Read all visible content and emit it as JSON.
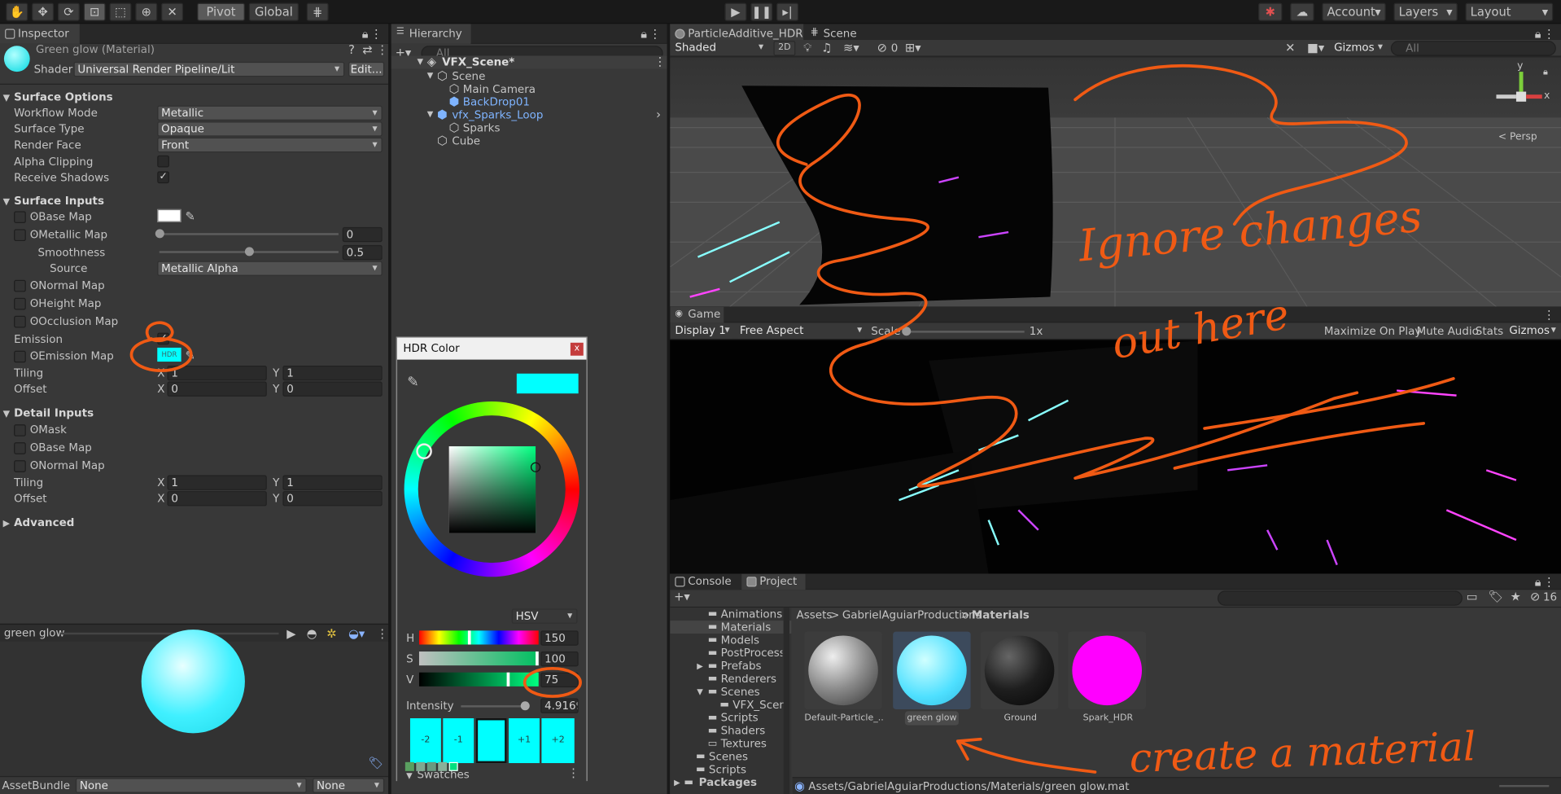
{
  "toolbar": {
    "pivot_label": "Pivot",
    "global_label": "Global",
    "account_label": "Account",
    "layers_label": "Layers",
    "layout_label": "Layout"
  },
  "inspector": {
    "tab_label": "Inspector",
    "material_name": "Green glow (Material)",
    "shader_label": "Shader",
    "shader_value": "Universal Render Pipeline/Lit",
    "edit_label": "Edit...",
    "surface_options": {
      "title": "Surface Options",
      "workflow_mode_label": "Workflow Mode",
      "workflow_mode_value": "Metallic",
      "surface_type_label": "Surface Type",
      "surface_type_value": "Opaque",
      "render_face_label": "Render Face",
      "render_face_value": "Front",
      "alpha_clipping_label": "Alpha Clipping",
      "receive_shadows_label": "Receive Shadows",
      "receive_shadows_check": "✓"
    },
    "surface_inputs": {
      "title": "Surface Inputs",
      "base_map_label": "Base Map",
      "metallic_map_label": "Metallic Map",
      "metallic_value": "0",
      "metallic_fraction": 0.0,
      "smoothness_label": "Smoothness",
      "smoothness_value": "0.5",
      "smoothness_fraction": 0.5,
      "source_label": "Source",
      "source_value": "Metallic Alpha",
      "normal_map_label": "Normal Map",
      "height_map_label": "Height Map",
      "occlusion_map_label": "Occlusion Map",
      "emission_label": "Emission",
      "emission_map_label": "Emission Map",
      "hdr_tag": "HDR",
      "tiling_label": "Tiling",
      "tiling_x": "1",
      "tiling_y": "1",
      "offset_label": "Offset",
      "offset_x": "0",
      "offset_y": "0",
      "x_label": "X",
      "y_label": "Y"
    },
    "detail_inputs": {
      "title": "Detail Inputs",
      "mask_label": "Mask",
      "base_map_label": "Base Map",
      "normal_map_label": "Normal Map",
      "tiling_label": "Tiling",
      "tiling_x": "1",
      "tiling_y": "1",
      "offset_label": "Offset",
      "offset_x": "0",
      "offset_y": "0"
    },
    "advanced_label": "Advanced",
    "preview_title": "green glow",
    "assetbundle_label": "AssetBundle",
    "assetbundle_value": "None",
    "assetbundle_variant": "None"
  },
  "hierarchy": {
    "tab_label": "Hierarchy",
    "search_placeholder": "All",
    "scene_name": "VFX_Scene*",
    "items": [
      "Scene",
      "Main Camera",
      "BackDrop01",
      "vfx_Sparks_Loop",
      "Sparks",
      "Cube"
    ]
  },
  "hdr_color": {
    "title": "HDR Color",
    "close": "x",
    "mode": "HSV",
    "h_label": "H",
    "h_value": "150",
    "s_label": "S",
    "s_value": "100",
    "v_label": "V",
    "v_value": "75",
    "intensity_label": "Intensity",
    "intensity_value": "4.9169",
    "intensity_fraction": 0.94,
    "swatch_buttons": [
      "-2",
      "-1",
      "",
      "+1",
      "+2"
    ],
    "swatches_label": "Swatches",
    "color_hex": "#00ffff"
  },
  "scene_view": {
    "tab1_label": "ParticleAdditive_HDR",
    "tab2_label": "Scene",
    "shading_mode": "Shaded",
    "mode_2d": "2D",
    "hidden_count": "0",
    "gizmos_label": "Gizmos",
    "search_placeholder": "All",
    "persp_label": "< Persp",
    "axis_y": "y",
    "axis_x": "x"
  },
  "game_view": {
    "tab_label": "Game",
    "display": "Display 1",
    "aspect": "Free Aspect",
    "scale_label": "Scale",
    "scale_value": "1x",
    "maximize_label": "Maximize On Play",
    "mute_label": "Mute Audio",
    "stats_label": "Stats",
    "gizmos_label": "Gizmos"
  },
  "project": {
    "console_tab": "Console",
    "project_tab": "Project",
    "hidden_count": "16",
    "breadcrumb": [
      "Assets",
      "GabrielAguiarProductions",
      "Materials"
    ],
    "breadcrumb_sep": ">",
    "folders": [
      "Animations",
      "Materials",
      "Models",
      "PostProcessi",
      "Prefabs",
      "Renderers",
      "Scenes",
      "VFX_Scene",
      "Scripts",
      "Shaders",
      "Textures",
      "Scenes",
      "Scripts",
      "Packages"
    ],
    "assets": [
      {
        "name": "Default-Particle_...",
        "color": "#8a8a8a"
      },
      {
        "name": "green glow",
        "color": "#4fe0ff"
      },
      {
        "name": "Ground",
        "color": "#1e1e1e"
      },
      {
        "name": "Spark_HDR",
        "color": "#ff00ff"
      }
    ],
    "path": "Assets/GabrielAguiarProductions/Materials/green glow.mat"
  },
  "annotations": {
    "ignore_changes_text": "Ignore changes",
    "out_here_text": "out here",
    "create_material_text": "create a material",
    "ink_color": "#f05a14"
  }
}
